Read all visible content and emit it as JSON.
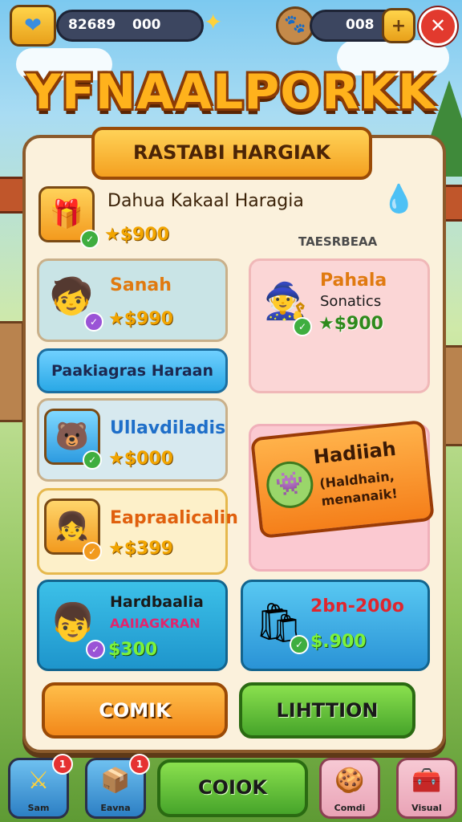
{
  "topbar": {
    "coins": "82689",
    "coins_extra": "000",
    "energy": "008"
  },
  "game_title": "YFNAALPORKK",
  "panel": {
    "banner": "RASTABI HARGIAK",
    "featured": {
      "name": "Dahua Kakaal Haragia",
      "price": "★$900"
    },
    "side_label": "TAESRBEAA",
    "section_header": "Paakiagras Haraan",
    "items": [
      {
        "name": "Sanah",
        "price": "★$990"
      },
      {
        "name": "Ullavdiladis",
        "price": "★$000"
      },
      {
        "name": "Eapraalicalin",
        "price": "★$399"
      },
      {
        "name": "Hardbaalia",
        "subtitle": "AAIIAGKRAN",
        "price": "$300"
      }
    ],
    "right_items": [
      {
        "name": "Pahala",
        "subtitle": "Sonatics",
        "price": "★$900"
      },
      {
        "name": "2bn-200o",
        "price": "$.900"
      }
    ],
    "promo": {
      "title": "Hadiiah",
      "subtitle": "(Haldhain,",
      "subtitle2": "menanaik!"
    },
    "btn_left": "COMIK",
    "btn_right": "LIHTTION"
  },
  "bottom_nav": {
    "left1": "Sam",
    "left1_badge": "1",
    "left2": "Eavna",
    "left2_badge": "1",
    "center": "COIOK",
    "right1": "Comdi",
    "right2": "Visual"
  },
  "colors": {
    "accent": "#f4a020",
    "green": "#56b92f",
    "panel": "#fbf1dc"
  }
}
